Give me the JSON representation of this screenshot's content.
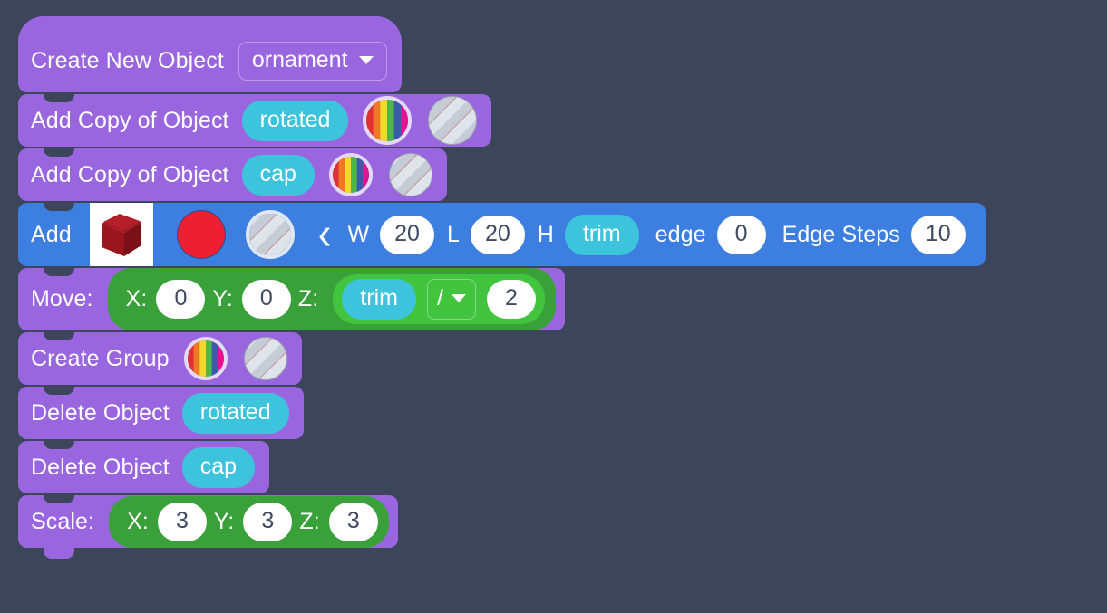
{
  "background_color": "#3c455a",
  "palette": {
    "purple_block": "#9966e0",
    "blue_block": "#3d7fe0",
    "green_operand": "#3aa03a",
    "green_bright": "#43c43f",
    "cyan_pill": "#3ec3dd",
    "white_field": "#ffffff",
    "red_shape": "#ee1f32"
  },
  "blocks": [
    {
      "id": "create-new-object",
      "label": "Create New Object",
      "dropdown_value": "ornament"
    },
    {
      "id": "add-copy-of-object-rotated",
      "label": "Add Copy of Object",
      "object_name": "rotated",
      "icons": [
        "rainbow-circle-icon",
        "striped-sphere-icon"
      ]
    },
    {
      "id": "add-copy-of-object-cap",
      "label": "Add Copy of Object",
      "object_name": "cap",
      "icons": [
        "rainbow-circle-icon",
        "striped-sphere-icon"
      ]
    },
    {
      "id": "add-shape",
      "label": "Add",
      "icons": [
        "red-cube-icon",
        "red-circle-icon",
        "striped-sphere-icon",
        "chevron-left-icon"
      ],
      "fields": [
        {
          "label": "W",
          "value": "20"
        },
        {
          "label": "L",
          "value": "20"
        },
        {
          "label": "H",
          "value": "trim",
          "type": "variable"
        },
        {
          "label": "edge",
          "value": "0"
        },
        {
          "label": "Edge Steps",
          "value": "10"
        }
      ]
    },
    {
      "id": "move",
      "label": "Move:",
      "axes": [
        {
          "label": "X:",
          "value": "0"
        },
        {
          "label": "Y:",
          "value": "0"
        },
        {
          "label": "Z:",
          "value": "trim",
          "operator": "/",
          "operand": "2"
        }
      ]
    },
    {
      "id": "create-group",
      "label": "Create Group",
      "icons": [
        "rainbow-circle-icon",
        "striped-sphere-icon"
      ]
    },
    {
      "id": "delete-object-rotated",
      "label": "Delete Object",
      "object_name": "rotated"
    },
    {
      "id": "delete-object-cap",
      "label": "Delete Object",
      "object_name": "cap"
    },
    {
      "id": "scale",
      "label": "Scale:",
      "axes": [
        {
          "label": "X:",
          "value": "3"
        },
        {
          "label": "Y:",
          "value": "3"
        },
        {
          "label": "Z:",
          "value": "3"
        }
      ]
    }
  ]
}
